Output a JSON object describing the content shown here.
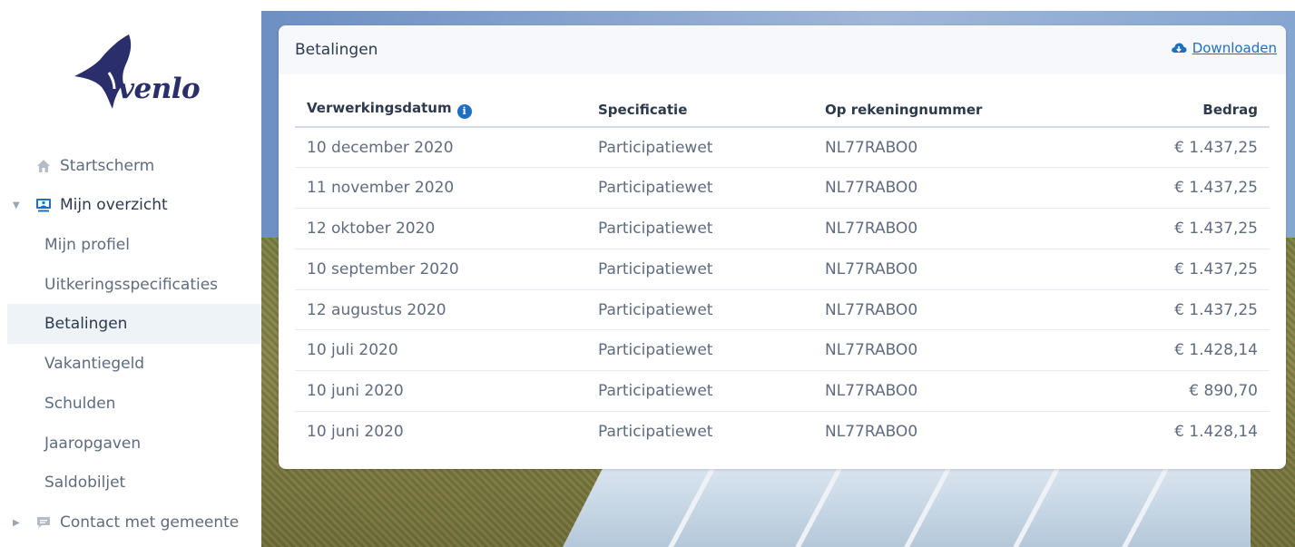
{
  "brand": {
    "logo_text": "venlo",
    "color_primary": "#2a2e6b",
    "color_link": "#1f6fc0"
  },
  "sidebar": {
    "items": [
      {
        "label": "Startscherm",
        "icon": "home-icon",
        "level": "top"
      },
      {
        "label": "Mijn overzicht",
        "icon": "user-monitor-icon",
        "level": "top",
        "expanded": true
      },
      {
        "label": "Mijn profiel",
        "level": "sub"
      },
      {
        "label": "Uitkeringsspecificaties",
        "level": "sub"
      },
      {
        "label": "Betalingen",
        "level": "sub",
        "active": true
      },
      {
        "label": "Vakantiegeld",
        "level": "sub"
      },
      {
        "label": "Schulden",
        "level": "sub"
      },
      {
        "label": "Jaaropgaven",
        "level": "sub"
      },
      {
        "label": "Saldobiljet",
        "level": "sub"
      },
      {
        "label": "Contact met gemeente",
        "icon": "chat-icon",
        "level": "top",
        "expanded": false
      }
    ]
  },
  "card": {
    "title": "Betalingen",
    "download_label": "Downloaden",
    "download_icon": "cloud-download-icon"
  },
  "table": {
    "headers": [
      "Verwerkingsdatum",
      "Specificatie",
      "Op rekeningnummer",
      "Bedrag"
    ],
    "rows": [
      [
        "10 december 2020",
        "Participatiewet",
        "NL77RABO0",
        "€ 1.437,25"
      ],
      [
        "11 november 2020",
        "Participatiewet",
        "NL77RABO0",
        "€ 1.437,25"
      ],
      [
        "12 oktober 2020",
        "Participatiewet",
        "NL77RABO0",
        "€ 1.437,25"
      ],
      [
        "10 september 2020",
        "Participatiewet",
        "NL77RABO0",
        "€ 1.437,25"
      ],
      [
        "12 augustus 2020",
        "Participatiewet",
        "NL77RABO0",
        "€ 1.437,25"
      ],
      [
        "10 juli 2020",
        "Participatiewet",
        "NL77RABO0",
        "€ 1.428,14"
      ],
      [
        "10 juni 2020",
        "Participatiewet",
        "NL77RABO0",
        "€ 890,70"
      ],
      [
        "10 juni 2020",
        "Participatiewet",
        "NL77RABO0",
        "€ 1.428,14"
      ]
    ]
  }
}
